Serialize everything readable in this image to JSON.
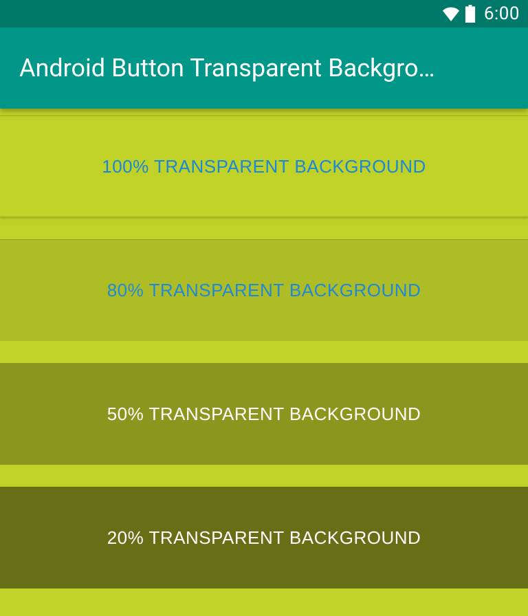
{
  "status": {
    "time": "6:00"
  },
  "app": {
    "title": "Android Button Transparent Backgro…"
  },
  "buttons": [
    {
      "label": "100% TRANSPARENT BACKGROUND",
      "opacity": 100,
      "text_color": "#1a88d6"
    },
    {
      "label": "80% TRANSPARENT BACKGROUND",
      "opacity": 80,
      "text_color": "#2089d6"
    },
    {
      "label": "50% TRANSPARENT BACKGROUND",
      "opacity": 50,
      "text_color": "#ffffff"
    },
    {
      "label": "20% TRANSPARENT BACKGROUND",
      "opacity": 20,
      "text_color": "#ffffff"
    }
  ],
  "colors": {
    "status_bar": "#00796b",
    "app_bar": "#009688",
    "background": "#c0d127"
  }
}
